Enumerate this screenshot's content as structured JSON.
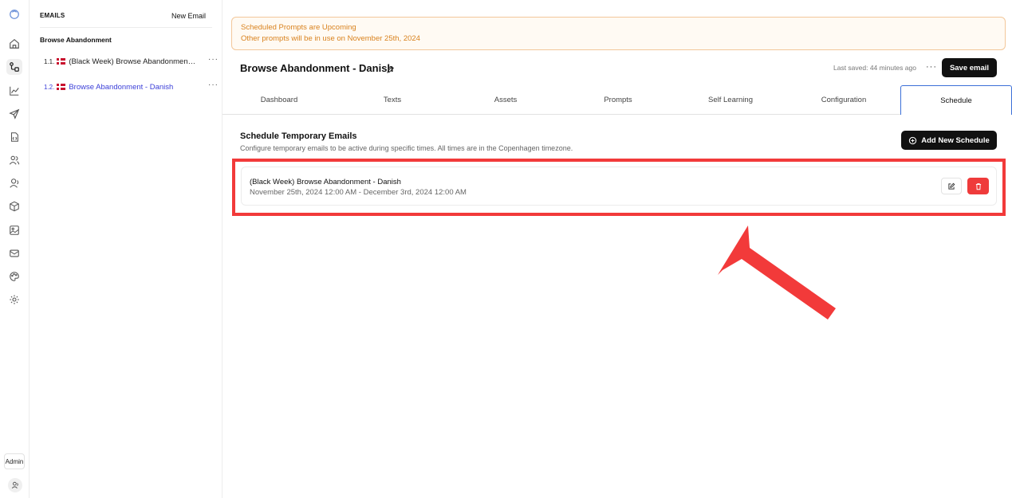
{
  "sidebar": {
    "header_title": "EMAILS",
    "new_email_label": "New Email",
    "group_label": "Browse Abandonment",
    "items": [
      {
        "number": "1.1.",
        "label": "(Black Week) Browse Abandonment - Danish",
        "selected": false,
        "flag": "danish-flag-icon"
      },
      {
        "number": "1.2.",
        "label": "Browse Abandonment - Danish",
        "selected": true,
        "flag": "danish-flag-icon"
      }
    ],
    "more_label": "···"
  },
  "rail": {
    "icons": [
      "logo-icon",
      "home-icon",
      "flows-icon",
      "analytics-icon",
      "send-icon",
      "file-code-icon",
      "users-icon",
      "user-icon",
      "box-icon",
      "image-icon",
      "mail-icon",
      "palette-icon",
      "settings-icon"
    ],
    "admin_label": "Admin",
    "user_icon": "user-avatar-icon"
  },
  "banner": {
    "title": "Scheduled Prompts are Upcoming",
    "text": "Other prompts will be in use on November 25th, 2024",
    "color": "#d9821e"
  },
  "header": {
    "title": "Browse Abandonment - Danish",
    "last_saved": "Last saved: 44 minutes ago",
    "more_label": "···",
    "save_label": "Save email"
  },
  "tabs": [
    {
      "label": "Dashboard",
      "active": false
    },
    {
      "label": "Texts",
      "active": false
    },
    {
      "label": "Assets",
      "active": false
    },
    {
      "label": "Prompts",
      "active": false
    },
    {
      "label": "Self Learning",
      "active": false
    },
    {
      "label": "Configuration",
      "active": false
    },
    {
      "label": "Schedule",
      "active": true
    }
  ],
  "schedule": {
    "title": "Schedule Temporary Emails",
    "description": "Configure temporary emails to be active during specific times. All times are in the Copenhagen timezone.",
    "add_label": "Add New Schedule",
    "entries": [
      {
        "name": "(Black Week) Browse Abandonment - Danish",
        "range": "November 25th, 2024 12:00 AM - December 3rd, 2024 12:00 AM"
      }
    ]
  },
  "colors": {
    "accent": "#3b3fd8",
    "annotation_red": "#f23a3a",
    "delete_red": "#ef3b3b"
  }
}
